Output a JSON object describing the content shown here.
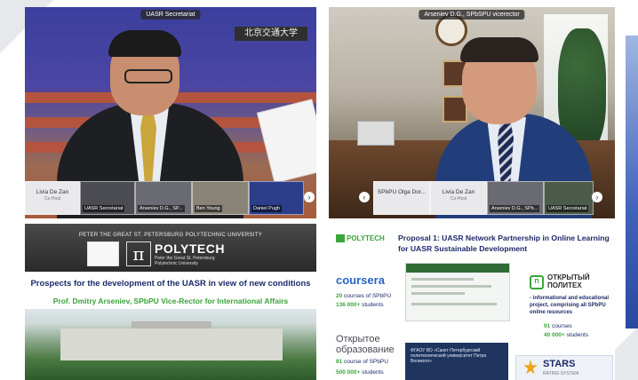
{
  "video_left": {
    "top_label": "UASR Secretariat",
    "wall_text": "北京交通大学",
    "tiles": [
      {
        "name": "Livia De Zan",
        "sub": "Co-Host",
        "light": true
      },
      {
        "name": "UASR Secretariat",
        "light": false
      },
      {
        "name": "Arseniev D.G., SP...",
        "light": false
      },
      {
        "name": "Ben Young",
        "light": false
      },
      {
        "name": "Daniel Pugh",
        "light": false
      }
    ]
  },
  "video_right": {
    "top_label": "Arseniev D.G., SPbSPU vicerector",
    "tiles": [
      {
        "name": "SPbPU Olga Dor...",
        "light": true
      },
      {
        "name": "Livia De Zan",
        "sub": "Co-Host",
        "light": true
      },
      {
        "name": "Arseniev D.G., SPb...",
        "light": false
      },
      {
        "name": "UASR Secretariat",
        "light": false
      }
    ]
  },
  "slide_left": {
    "university": "PETER THE GREAT ST. PETERSBURG POLYTECHNIC UNIVERSITY",
    "logo_pi": "π",
    "brand": "POLYTECH",
    "brand_sub": "Peter the Great St. Petersburg Polytechnic University",
    "title": "Prospects for the development of the UASR in view of new conditions",
    "speaker": "Prof. Dmitry Arseniev, SPbPU Vice-Rector for International Affairs"
  },
  "slide_right": {
    "logo": "POLYTECH",
    "title": "Proposal 1: UASR Network Partnership in Online Learning for UASR Sustainable Development",
    "coursera": {
      "name": "coursera",
      "courses_value": "20",
      "courses_label": "courses of SPbPU",
      "students_value": "136 000+",
      "students_label": "students"
    },
    "open_polytech": {
      "mark": "П",
      "name_line1": "ОТКРЫТЫЙ",
      "name_line2": "ПОЛИТЕХ",
      "desc": "- informational and educational project, comprising all SPbPU online resources",
      "courses_value": "91",
      "courses_label": "courses",
      "students_value": "40 000+",
      "students_label": "students"
    },
    "open_edu": {
      "name_line1": "Открытое",
      "name_line2": "образование",
      "courses_value": "81",
      "courses_label": "course of SPbPU",
      "students_value": "500 000+",
      "students_label": "students"
    },
    "shot2_text": "ФГАОУ ВО «Санкт-Петербургский политехнический университет Петра Великого»",
    "stars": {
      "name": "STARS",
      "sub": "RATING SYSTEM"
    }
  },
  "colors": {
    "title_navy": "#1d2a6a",
    "accent_green": "#3aa53a",
    "coursera_blue": "#2a63c4"
  }
}
